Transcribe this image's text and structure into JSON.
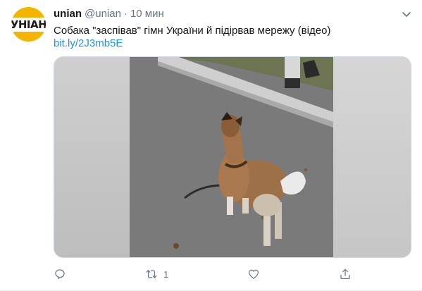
{
  "tweet": {
    "avatar_text": "УНІАН",
    "display_name": "unian",
    "handle": "@unian",
    "separator": "·",
    "time": "10 мин",
    "text": "Собака \"заспівав\" гімн України й підірвав мережу (відео)",
    "link": "bit.ly/2J3mb5E"
  },
  "media": {
    "type": "video-thumbnail",
    "subject": "dog"
  },
  "actions": {
    "reply_icon": "reply-icon",
    "retweet_icon": "retweet-icon",
    "retweet_count": "1",
    "like_icon": "like-icon",
    "share_icon": "share-icon"
  },
  "colors": {
    "link": "#1b95e0",
    "secondary": "#657786",
    "avatar_bg": "#f4b400"
  }
}
